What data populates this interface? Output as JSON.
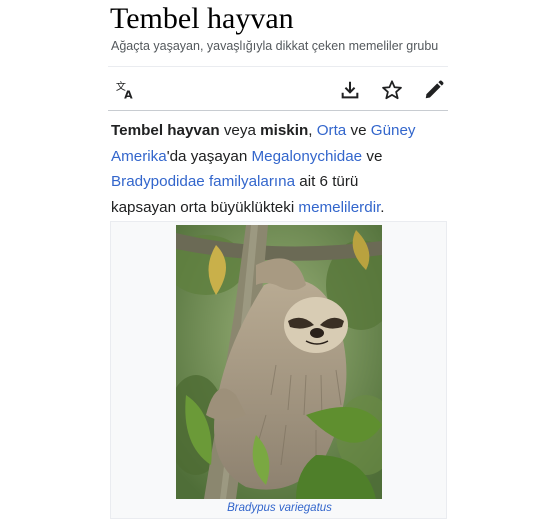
{
  "page": {
    "title": "Tembel hayvan",
    "subtitle": "Ağaçta yaşayan, yavaşlığıyla dikkat çeken memeliler grubu"
  },
  "toolbar": {
    "language_icon": "translate-icon",
    "download_icon": "download-icon",
    "watch_icon": "star-icon",
    "edit_icon": "pencil-icon"
  },
  "intro": {
    "bold1": "Tembel hayvan",
    "t1": " veya ",
    "bold2": "miskin",
    "t2": ", ",
    "link1": "Orta",
    "t3": " ve ",
    "link2": "Güney Amerika",
    "t4": "'da yaşayan ",
    "link3": "Megalonychidae",
    "t5": " ve ",
    "link4": "Bradypodidae familyalarına",
    "t6": " ait 6 türü kapsayan orta büyüklükteki ",
    "link5": "memelilerdir",
    "t7": "."
  },
  "figure": {
    "caption": "Bradypus variegatus"
  },
  "colors": {
    "link": "#3366cc",
    "text": "#202122",
    "muted": "#54595d"
  }
}
